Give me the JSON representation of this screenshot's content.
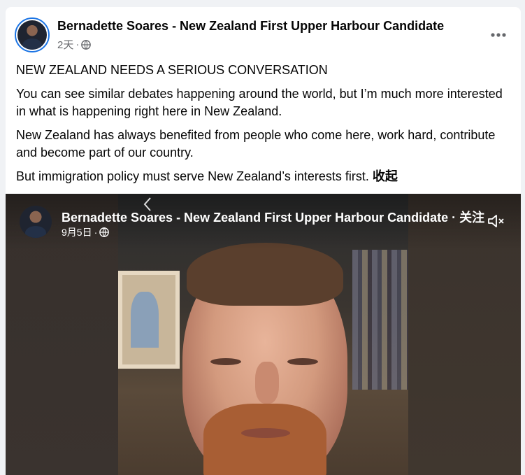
{
  "post": {
    "author": "Bernadette Soares - New Zealand First Upper Harbour Candidate",
    "time": "2天",
    "paragraphs": [
      "NEW ZEALAND NEEDS A SERIOUS CONVERSATION",
      "You can see similar debates happening around the world, but I’m much more interested in what is happening right here in New Zealand.",
      "New Zealand has always benefited from people who come here, work hard, contribute and become part of our country."
    ],
    "last_paragraph": "But immigration policy must serve New Zealand’s interests first.",
    "see_less": "收起"
  },
  "video": {
    "author": "Bernadette Soares - New Zealand First Upper Harbour Candidate",
    "separator": " · ",
    "follow": "关注",
    "date": "9月5日",
    "muted": true
  },
  "colors": {
    "accent": "#1b74e4",
    "secondary_text": "#65676b",
    "background": "#f0f2f5"
  },
  "icons": {
    "more": "more-horizontal-icon",
    "privacy": "globe-icon",
    "mute": "speaker-muted-icon",
    "prev": "chevron-left-icon"
  }
}
